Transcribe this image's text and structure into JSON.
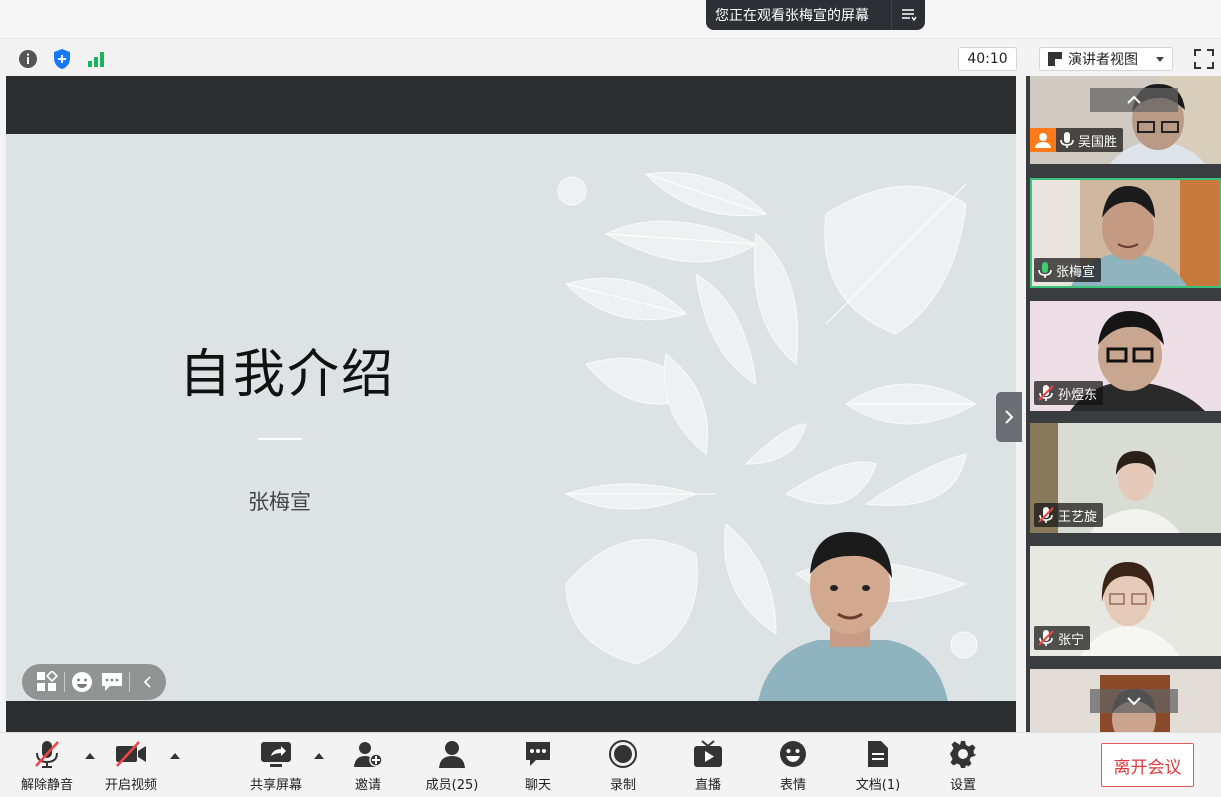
{
  "share_banner": {
    "text": "您正在观看张梅宣的屏幕"
  },
  "top_toolbar": {
    "timer": "40:10",
    "view_mode": "演讲者视图"
  },
  "slide": {
    "title": "自我介绍",
    "subtitle": "张梅宣"
  },
  "participants": [
    {
      "name": "吴国胜",
      "mic": "on",
      "skin": "#b99a86",
      "bg": "#cfcac2"
    },
    {
      "name": "张梅宣",
      "mic": "speaking",
      "skin": "#c49a82",
      "bg": "#d0b8a0"
    },
    {
      "name": "孙煜东",
      "mic": "muted",
      "skin": "#c9a690",
      "bg": "#eedfe6"
    },
    {
      "name": "王艺旋",
      "mic": "muted",
      "skin": "#e4c8b8",
      "bg": "#d9dcd2"
    },
    {
      "name": "张宁",
      "mic": "muted",
      "skin": "#e6cab8",
      "bg": "#e8e8e2"
    }
  ],
  "bottom_toolbar": {
    "unmute": "解除静音",
    "start_video": "开启视频",
    "share_screen": "共享屏幕",
    "invite": "邀请",
    "members": "成员(25)",
    "chat": "聊天",
    "record": "录制",
    "live": "直播",
    "reactions": "表情",
    "docs": "文档(1)",
    "settings": "设置",
    "leave": "离开会议"
  },
  "colors": {
    "leave_red": "#e0393e",
    "active_green": "#39c27a",
    "stage_dark": "#2b2e31",
    "slide_bg": "#dde2e4"
  }
}
